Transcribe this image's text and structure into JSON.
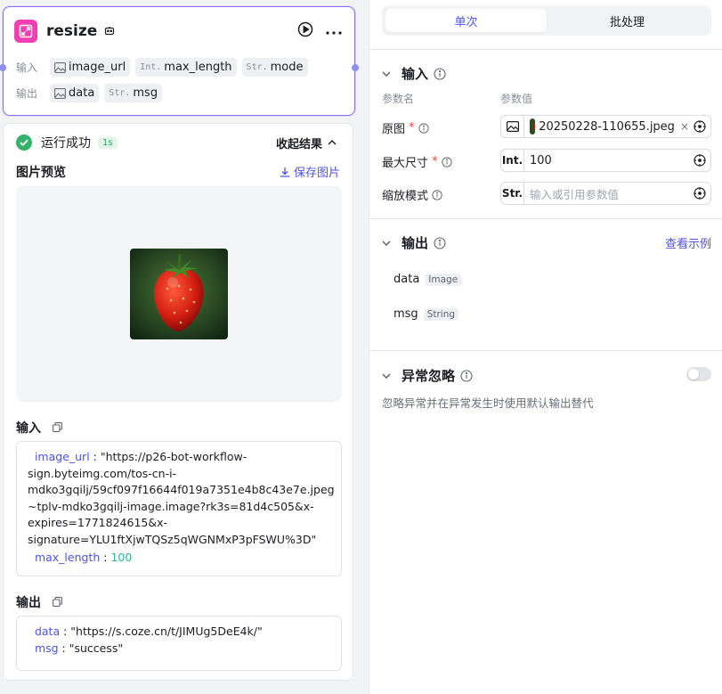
{
  "node": {
    "title": "resize",
    "inputs_label": "输入",
    "outputs_label": "输出",
    "inputs": [
      {
        "type": "image",
        "name": "image_url"
      },
      {
        "type": "Int.",
        "name": "max_length"
      },
      {
        "type": "Str.",
        "name": "mode"
      }
    ],
    "outputs": [
      {
        "type": "image",
        "name": "data"
      },
      {
        "type": "Str.",
        "name": "msg"
      }
    ]
  },
  "result": {
    "status": "运行成功",
    "duration": "1s",
    "collapse_label": "收起结果",
    "preview_title": "图片预览",
    "save_label": "保存图片",
    "input_title": "输入",
    "input_lines": [
      {
        "key": "image_url",
        "value": "\"https://p26-bot-workflow-"
      },
      {
        "key": "",
        "value": "sign.byteimg.com/tos-cn-i-"
      },
      {
        "key": "",
        "value": "mdko3gqilj/59cf097f16644f019a7351e4b8c43e7e.jpeg"
      },
      {
        "key": "",
        "value": "~tplv-mdko3gqilj-image.image?rk3s=81d4c505&x-"
      },
      {
        "key": "",
        "value": "expires=1771824615&x-"
      },
      {
        "key": "",
        "value": "signature=YLU1ftXjwTQSz5qWGNMxP3pFSWU%3D\""
      }
    ],
    "max_length_key": "max_length",
    "max_length_value": "100",
    "output_title": "输出",
    "output_lines": [
      {
        "key": "data",
        "value": "\"https://s.coze.cn/t/JIMUg5DeE4k/\""
      },
      {
        "key": "msg",
        "value": "\"success\""
      }
    ]
  },
  "tabs": [
    {
      "label": "单次",
      "active": true
    },
    {
      "label": "批处理",
      "active": false
    }
  ],
  "input_section": {
    "title": "输入",
    "col_name": "参数名",
    "col_value": "参数值",
    "params": [
      {
        "label": "原图",
        "required": true,
        "type": "image",
        "value": "20250228-110655.jpeg"
      },
      {
        "label": "最大尺寸",
        "required": true,
        "type": "Int.",
        "value": "100"
      },
      {
        "label": "缩放模式",
        "required": false,
        "type": "Str.",
        "placeholder": "输入或引用参数值"
      }
    ]
  },
  "output_section": {
    "title": "输出",
    "example_link": "查看示例",
    "outputs": [
      {
        "name": "data",
        "type": "Image"
      },
      {
        "name": "msg",
        "type": "String"
      }
    ]
  },
  "exception_section": {
    "title": "异常忽略",
    "enabled": false,
    "description": "忽略异常并在异常发生时使用默认输出替代"
  },
  "colors": {
    "accent": "#4d53e8",
    "success": "#34b36b",
    "node_icon": "#f03fb0",
    "required": "#e5484d"
  },
  "icons": [
    "resize-node-icon",
    "bot-icon",
    "play-icon",
    "more-icon",
    "image-type-icon",
    "check-circle-icon",
    "chevron-up-icon",
    "download-icon",
    "copy-icon",
    "chevron-down-icon",
    "info-icon",
    "reference-variable-icon",
    "clear-icon"
  ]
}
